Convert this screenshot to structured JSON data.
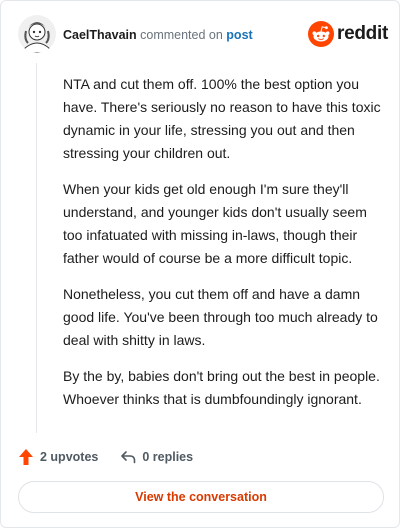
{
  "comment": {
    "username": "CaelThavain",
    "commented_on_text": "commented on",
    "post_link": "post",
    "paragraphs": [
      "NTA and cut them off. 100% the best option you have. There's seriously no reason to have this toxic dynamic in your life, stressing you out and then stressing your children out.",
      "When your kids get old enough I'm sure they'll understand, and younger kids don't usually seem too infatuated with missing in-laws, though their father would of course be a more difficult topic.",
      "Nonetheless, you cut them off and have a damn good life. You've been through too much already to deal with shitty in laws.",
      "By the by, babies don't bring out the best in people. Whoever thinks that is dumbfoundingly ignorant."
    ]
  },
  "brand": {
    "name": "reddit",
    "icon": "reddit-logo-icon",
    "color": "#ff4500"
  },
  "actions": {
    "upvotes": "2 upvotes",
    "upvote_icon": "upvote-arrow-icon",
    "upvote_color": "#ff4500",
    "replies": "0 replies",
    "reply_icon": "reply-arrow-icon"
  },
  "view_button": {
    "label": "View the conversation",
    "color": "#d93a00"
  }
}
